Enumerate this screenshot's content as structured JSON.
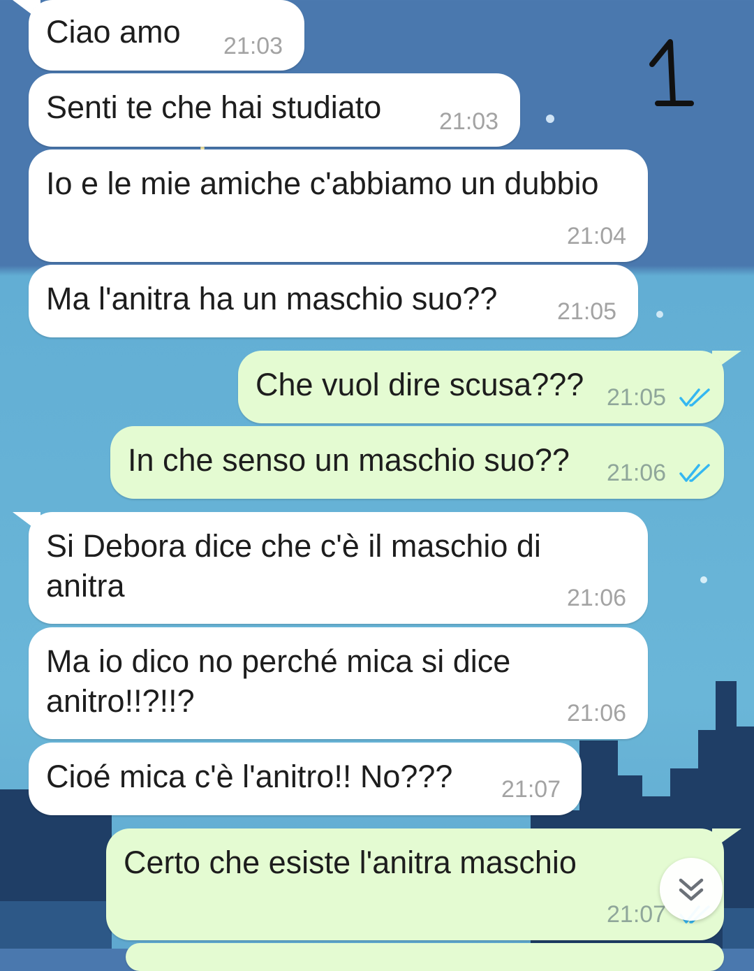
{
  "annotation_mark": "1",
  "messages": [
    {
      "dir": "in",
      "text": "Ciao amo",
      "time": "21:03"
    },
    {
      "dir": "in",
      "text": "Senti te che hai studiato",
      "time": "21:03"
    },
    {
      "dir": "in",
      "text": "Io e le mie amiche c'abbiamo un dubbio",
      "time": "21:04"
    },
    {
      "dir": "in",
      "text": "Ma l'anitra ha un maschio suo??",
      "time": "21:05"
    },
    {
      "dir": "out",
      "text": "Che vuol dire scusa???",
      "time": "21:05",
      "status": "read"
    },
    {
      "dir": "out",
      "text": "In che senso un maschio suo??",
      "time": "21:06",
      "status": "read"
    },
    {
      "dir": "in",
      "line1": "Si Debora dice che c'è il maschio di",
      "line2": "anitra",
      "time": "21:06"
    },
    {
      "dir": "in",
      "line1": "Ma io dico no perché mica si dice",
      "line2": "anitro!!?!!?",
      "time": "21:06"
    },
    {
      "dir": "in",
      "text": "Cioé mica c'è l'anitro!! No???",
      "time": "21:07"
    },
    {
      "dir": "out",
      "text": "Certo che esiste l'anitra maschio",
      "time": "21:07",
      "status": "read"
    }
  ],
  "colors": {
    "incoming_bubble": "#ffffff",
    "outgoing_bubble": "#e4fbd2",
    "read_checks": "#34b7f1"
  },
  "icons": {
    "read_receipt": "double-check-icon",
    "scroll_down": "chevron-double-down-icon"
  }
}
